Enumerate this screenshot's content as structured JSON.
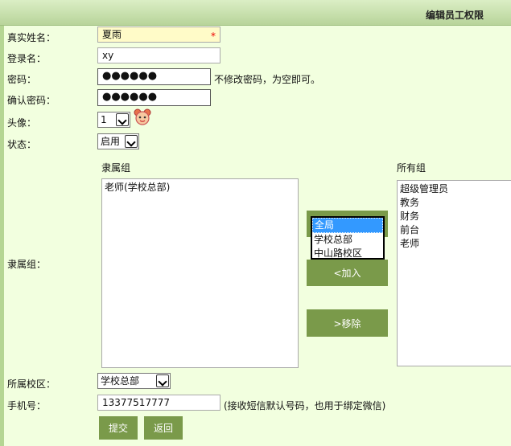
{
  "page": {
    "title": "编辑员工权限"
  },
  "form": {
    "real_name": {
      "label": "真实姓名：",
      "value": "夏雨",
      "required_mark": "*"
    },
    "login_name": {
      "label": "登录名：",
      "value": "xy"
    },
    "password": {
      "label": "密码：",
      "value": "●●●●●●",
      "hint": "不修改密码，为空即可。"
    },
    "confirm_password": {
      "label": "确认密码：",
      "value": "●●●●●●"
    },
    "avatar": {
      "label": "头像：",
      "value": "1"
    },
    "status": {
      "label": "状态：",
      "value": "启用"
    },
    "groups": {
      "label": "隶属组：",
      "assigned_header": "隶属组",
      "all_header": "所有组",
      "assigned": [
        "老师(学校总部)"
      ],
      "all": [
        "超级管理员",
        "教务",
        "财务",
        "前台",
        "老师"
      ],
      "scope_options": [
        "全局",
        "学校总部",
        "中山路校区"
      ],
      "scope_selected": "全局",
      "add_label": "<加入",
      "remove_label": ">移除"
    },
    "campus": {
      "label": "所属校区：",
      "value": "学校总部"
    },
    "phone": {
      "label": "手机号：",
      "value": "13377517777",
      "hint": "(接收短信默认号码，也用于绑定微信)"
    }
  },
  "buttons": {
    "submit": "提交",
    "back": "返回"
  },
  "colors": {
    "accent": "#7a9a4a",
    "background": "#f2ffdf",
    "required_field": "#fffbc8",
    "selection": "#3399ff"
  }
}
